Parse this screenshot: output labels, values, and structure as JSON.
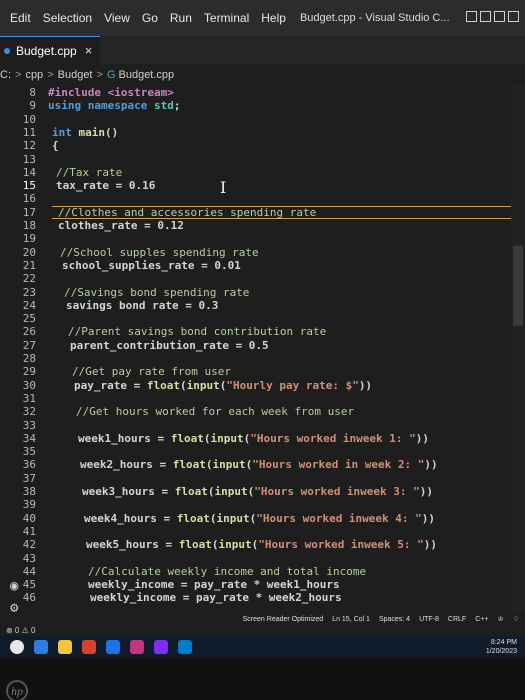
{
  "menu": {
    "items": [
      "Edit",
      "Selection",
      "View",
      "Go",
      "Run",
      "Terminal",
      "Help"
    ],
    "window_title": "Budget.cpp - Visual Studio C..."
  },
  "tab": {
    "label": "Budget.cpp",
    "close_glyph": "×"
  },
  "breadcrumb": {
    "drive": "C:",
    "folder1": "cpp",
    "folder2": "Budget",
    "file": "Budget.cpp"
  },
  "editor": {
    "current_line": 15,
    "lines": [
      {
        "n": "8",
        "indent": 48,
        "parts": [
          [
            "pp",
            "#include <iostream>"
          ]
        ]
      },
      {
        "n": "9",
        "indent": 48,
        "parts": [
          [
            "kw",
            "using "
          ],
          [
            "kw",
            "namespace "
          ],
          [
            "ns",
            "std"
          ],
          [
            "op",
            ";"
          ]
        ]
      },
      {
        "n": "10",
        "indent": 48,
        "parts": []
      },
      {
        "n": "11",
        "indent": 52,
        "parts": [
          [
            "kw",
            "int "
          ],
          [
            "fn",
            "main"
          ],
          [
            "op",
            "()"
          ]
        ]
      },
      {
        "n": "12",
        "indent": 52,
        "parts": [
          [
            "op",
            "{"
          ]
        ]
      },
      {
        "n": "13",
        "indent": 52,
        "parts": []
      },
      {
        "n": "14",
        "indent": 56,
        "parts": [
          [
            "cm",
            "//Tax rate"
          ]
        ]
      },
      {
        "n": "15",
        "indent": 56,
        "parts": [
          [
            "op",
            "tax_rate = 0.16"
          ]
        ]
      },
      {
        "n": "16",
        "indent": 56,
        "parts": []
      },
      {
        "n": "17",
        "indent": 58,
        "parts": [
          [
            "cm",
            "//Clothes and accessories spending rate"
          ]
        ]
      },
      {
        "n": "18",
        "indent": 58,
        "parts": [
          [
            "op",
            "clothes_rate = 0.12"
          ]
        ]
      },
      {
        "n": "19",
        "indent": 58,
        "parts": []
      },
      {
        "n": "20",
        "indent": 60,
        "parts": [
          [
            "cm",
            "//School supples spending rate"
          ]
        ]
      },
      {
        "n": "21",
        "indent": 62,
        "parts": [
          [
            "op",
            "school_supplies_rate = 0.01"
          ]
        ]
      },
      {
        "n": "22",
        "indent": 62,
        "parts": []
      },
      {
        "n": "23",
        "indent": 64,
        "parts": [
          [
            "cm",
            "//Savings bond spending rate"
          ]
        ]
      },
      {
        "n": "24",
        "indent": 66,
        "parts": [
          [
            "op",
            "savings bond rate = 0.3"
          ]
        ]
      },
      {
        "n": "25",
        "indent": 66,
        "parts": []
      },
      {
        "n": "26",
        "indent": 68,
        "parts": [
          [
            "cm",
            "//Parent savings bond contribution rate"
          ]
        ]
      },
      {
        "n": "27",
        "indent": 70,
        "parts": [
          [
            "op",
            "parent_contribution_rate = 0.5"
          ]
        ]
      },
      {
        "n": "28",
        "indent": 70,
        "parts": []
      },
      {
        "n": "29",
        "indent": 72,
        "parts": [
          [
            "cm",
            "//Get pay rate from user"
          ]
        ]
      },
      {
        "n": "30",
        "indent": 74,
        "parts": [
          [
            "op",
            "pay_rate = "
          ],
          [
            "fn",
            "float"
          ],
          [
            "op",
            "("
          ],
          [
            "fn",
            "input"
          ],
          [
            "op",
            "("
          ],
          [
            "str",
            "\"Hourly pay rate: $\""
          ],
          [
            "op",
            "))"
          ]
        ]
      },
      {
        "n": "31",
        "indent": 74,
        "parts": []
      },
      {
        "n": "32",
        "indent": 76,
        "parts": [
          [
            "cm",
            "//Get hours worked for each week from user"
          ]
        ]
      },
      {
        "n": "33",
        "indent": 76,
        "parts": []
      },
      {
        "n": "34",
        "indent": 78,
        "parts": [
          [
            "op",
            "week1_hours = "
          ],
          [
            "fn",
            "float"
          ],
          [
            "op",
            "("
          ],
          [
            "fn",
            "input"
          ],
          [
            "op",
            "("
          ],
          [
            "str",
            "\"Hours worked inweek 1: \""
          ],
          [
            "op",
            "))"
          ]
        ]
      },
      {
        "n": "35",
        "indent": 78,
        "parts": []
      },
      {
        "n": "36",
        "indent": 80,
        "parts": [
          [
            "op",
            "week2_hours = "
          ],
          [
            "fn",
            "float"
          ],
          [
            "op",
            "("
          ],
          [
            "fn",
            "input"
          ],
          [
            "op",
            "("
          ],
          [
            "str",
            "\"Hours worked in week 2: \""
          ],
          [
            "op",
            "))"
          ]
        ]
      },
      {
        "n": "37",
        "indent": 80,
        "parts": []
      },
      {
        "n": "38",
        "indent": 82,
        "parts": [
          [
            "op",
            "week3_hours = "
          ],
          [
            "fn",
            "float"
          ],
          [
            "op",
            "("
          ],
          [
            "fn",
            "input"
          ],
          [
            "op",
            "("
          ],
          [
            "str",
            "\"Hours worked inweek 3: \""
          ],
          [
            "op",
            "))"
          ]
        ]
      },
      {
        "n": "39",
        "indent": 82,
        "parts": []
      },
      {
        "n": "40",
        "indent": 84,
        "parts": [
          [
            "op",
            "week4_hours = "
          ],
          [
            "fn",
            "float"
          ],
          [
            "op",
            "("
          ],
          [
            "fn",
            "input"
          ],
          [
            "op",
            "("
          ],
          [
            "str",
            "\"Hours worked inweek 4: \""
          ],
          [
            "op",
            "))"
          ]
        ]
      },
      {
        "n": "41",
        "indent": 84,
        "parts": []
      },
      {
        "n": "42",
        "indent": 86,
        "parts": [
          [
            "op",
            "week5_hours = "
          ],
          [
            "fn",
            "float"
          ],
          [
            "op",
            "("
          ],
          [
            "fn",
            "input"
          ],
          [
            "op",
            "("
          ],
          [
            "str",
            "\"Hours worked inweek 5: \""
          ],
          [
            "op",
            "))"
          ]
        ]
      },
      {
        "n": "43",
        "indent": 86,
        "parts": []
      },
      {
        "n": "44",
        "indent": 88,
        "parts": [
          [
            "cm",
            "//Calculate weekly income and total income"
          ]
        ]
      },
      {
        "n": "45",
        "indent": 88,
        "parts": [
          [
            "op",
            "weekly_income = pay_rate * week1_hours"
          ]
        ]
      },
      {
        "n": "46",
        "indent": 90,
        "parts": [
          [
            "op",
            "weekly_income = pay_rate * week2_hours"
          ]
        ]
      }
    ]
  },
  "status": {
    "screen_reader": "Screen Reader Optimized",
    "position": "Ln 15, Col 1",
    "spaces": "Spaces: 4",
    "encoding": "UTF-8",
    "eol": "CRLF",
    "language": "C++",
    "problems": "⊗ 0 ⚠ 0"
  },
  "tray": {
    "time": "8:24 PM",
    "date": "1/20/2023"
  },
  "brand": "hp"
}
